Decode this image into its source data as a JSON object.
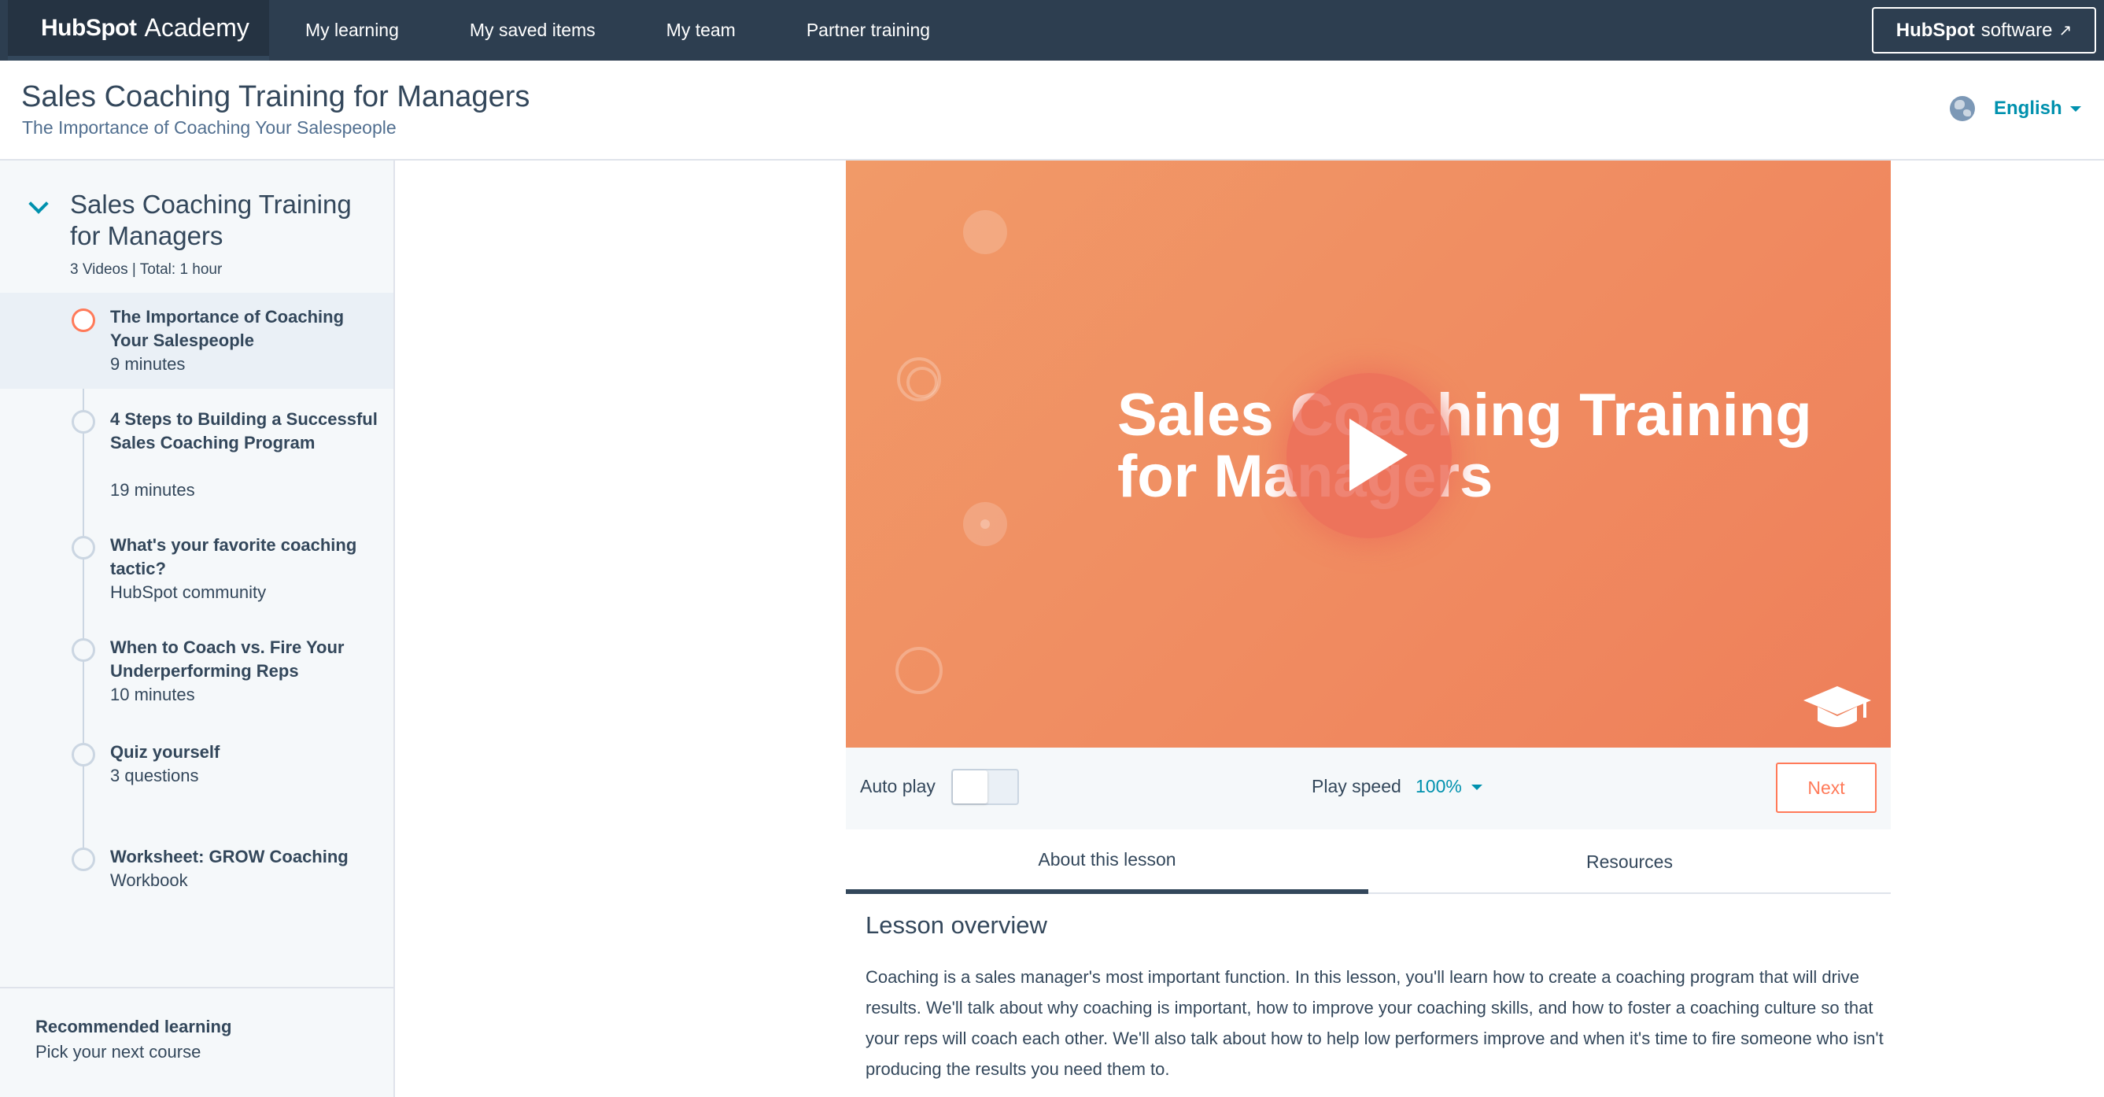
{
  "topnav": {
    "logo_brand": "HubSpot",
    "logo_product": "Academy",
    "links": [
      "My learning",
      "My saved items",
      "My team",
      "Partner training"
    ],
    "software_brand": "HubSpot",
    "software_label": "software"
  },
  "header": {
    "title": "Sales Coaching Training for Managers",
    "subtitle": "The Importance of Coaching Your Salespeople",
    "language": "English"
  },
  "sidebar": {
    "course_title": "Sales Coaching Training for Managers",
    "course_meta": "3 Videos | Total: 1 hour",
    "lessons": [
      {
        "title": "The Importance of Coaching Your Salespeople",
        "sub": "9 minutes"
      },
      {
        "title": "4 Steps to Building a Successful Sales Coaching Program",
        "sub": "19 minutes"
      },
      {
        "title": "What's your favorite coaching tactic?",
        "sub": "HubSpot community"
      },
      {
        "title": "When to Coach vs. Fire Your Underperforming Reps",
        "sub": "10 minutes"
      },
      {
        "title": "Quiz yourself",
        "sub": "3 questions"
      },
      {
        "title": "Worksheet: GROW Coaching",
        "sub": "Workbook"
      }
    ],
    "recommended_title": "Recommended learning",
    "recommended_sub": "Pick your next course"
  },
  "video": {
    "title": "Sales Coaching Training for Managers"
  },
  "controls": {
    "autoplay_label": "Auto play",
    "speed_label": "Play speed",
    "speed_value": "100%",
    "next_label": "Next"
  },
  "tabs": [
    "About this lesson",
    "Resources"
  ],
  "overview": {
    "title": "Lesson overview",
    "body": "Coaching is a sales manager's most important function. In this lesson, you'll learn how to create a coaching program that will drive results. We'll talk about why coaching is important, how to improve your coaching skills, and how to foster a coaching culture so that your reps will coach each other. We'll also talk about how to help low performers improve and when it's time to fire someone who isn't producing the results you need them to."
  },
  "colors": {
    "nav_bg": "#2d3e50",
    "accent": "#0091ae",
    "orange": "#ff7a59"
  }
}
